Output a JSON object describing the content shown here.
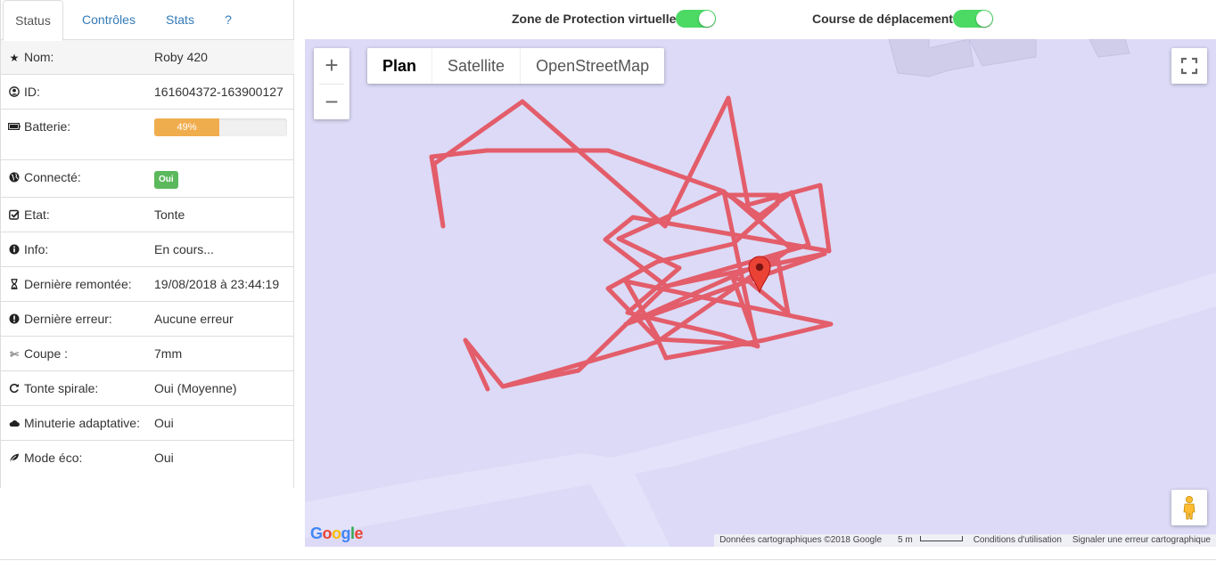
{
  "tabs": [
    "Status",
    "Contrôles",
    "Stats",
    "?"
  ],
  "info": [
    {
      "icon": "star-icon",
      "label": "Nom:",
      "value": "Roby 420"
    },
    {
      "icon": "user-circle-icon",
      "label": "ID:",
      "value": "161604372-163900127"
    },
    {
      "icon": "battery-icon",
      "label": "Batterie:",
      "progress": 0.49,
      "progress_label": "49%"
    },
    {
      "icon": "globe-icon",
      "label": "Connecté:",
      "badge": "Oui"
    },
    {
      "icon": "check-square-icon",
      "label": "Etat:",
      "value": "Tonte"
    },
    {
      "icon": "info-circle-icon",
      "label": "Info:",
      "value": "En cours..."
    },
    {
      "icon": "hourglass-icon",
      "label": "Dernière remontée:",
      "value": "19/08/2018 à 23:44:19"
    },
    {
      "icon": "exclamation-circle-icon",
      "label": "Dernière erreur:",
      "value": "Aucune erreur"
    },
    {
      "icon": "scissors-icon",
      "label": "Coupe :",
      "value": "7mm"
    },
    {
      "icon": "refresh-icon",
      "label": "Tonte spirale:",
      "value": "Oui (Moyenne)"
    },
    {
      "icon": "cloud-icon",
      "label": "Minuterie adaptative:",
      "value": "Oui"
    },
    {
      "icon": "leaf-icon",
      "label": "Mode éco:",
      "value": "Oui"
    }
  ],
  "toggles": {
    "zone": {
      "label": "Zone de Protection virtuelle",
      "on": true
    },
    "course": {
      "label": "Course de déplacement",
      "on": true
    }
  },
  "map": {
    "map_types": [
      "Plan",
      "Satellite",
      "OpenStreetMap"
    ],
    "active_type": "Plan",
    "zoom_in": "+",
    "zoom_out": "−",
    "logo": "Google",
    "attribution": "Données cartographiques ©2018 Google",
    "scale": "5 m",
    "terms": "Conditions d'utilisation",
    "report": "Signaler une erreur cartographique",
    "path_color": "#e35d6a",
    "marker_color": "#ea4335"
  }
}
